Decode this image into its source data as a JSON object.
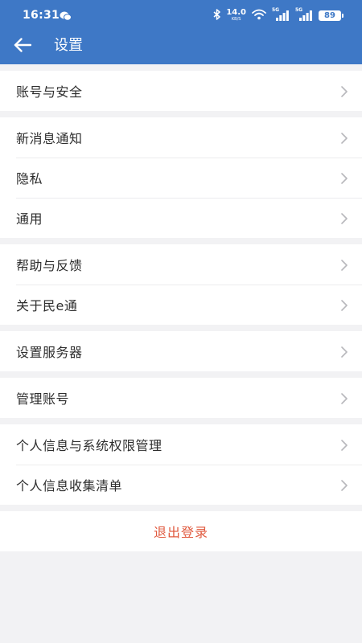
{
  "status_bar": {
    "time": "16:31",
    "net_speed_value": "14.0",
    "net_speed_unit": "KB/S",
    "sim1_tag": "5G",
    "sim2_tag": "5G",
    "battery": "89",
    "left_icon": "chat-bubbles-icon",
    "right_icons": [
      "bluetooth-icon",
      "wifi-icon",
      "signal-icon",
      "signal-icon",
      "battery-icon"
    ]
  },
  "header": {
    "title": "设置",
    "back_icon": "arrow-left-icon",
    "background_color": "#3e78c6"
  },
  "groups": [
    {
      "items": [
        {
          "label": "账号与安全"
        }
      ]
    },
    {
      "items": [
        {
          "label": "新消息通知"
        },
        {
          "label": "隐私"
        },
        {
          "label": "通用"
        }
      ]
    },
    {
      "items": [
        {
          "label": "帮助与反馈"
        },
        {
          "label": "关于民e通"
        }
      ]
    },
    {
      "items": [
        {
          "label": "设置服务器"
        }
      ]
    },
    {
      "items": [
        {
          "label": "管理账号"
        }
      ]
    },
    {
      "items": [
        {
          "label": "个人信息与系统权限管理"
        },
        {
          "label": "个人信息收集清单"
        }
      ]
    }
  ],
  "logout": {
    "label": "退出登录",
    "color": "#e05a3f"
  },
  "colors": {
    "page_background": "#f2f2f4",
    "row_background": "#ffffff",
    "chevron": "#b8b8bc"
  }
}
